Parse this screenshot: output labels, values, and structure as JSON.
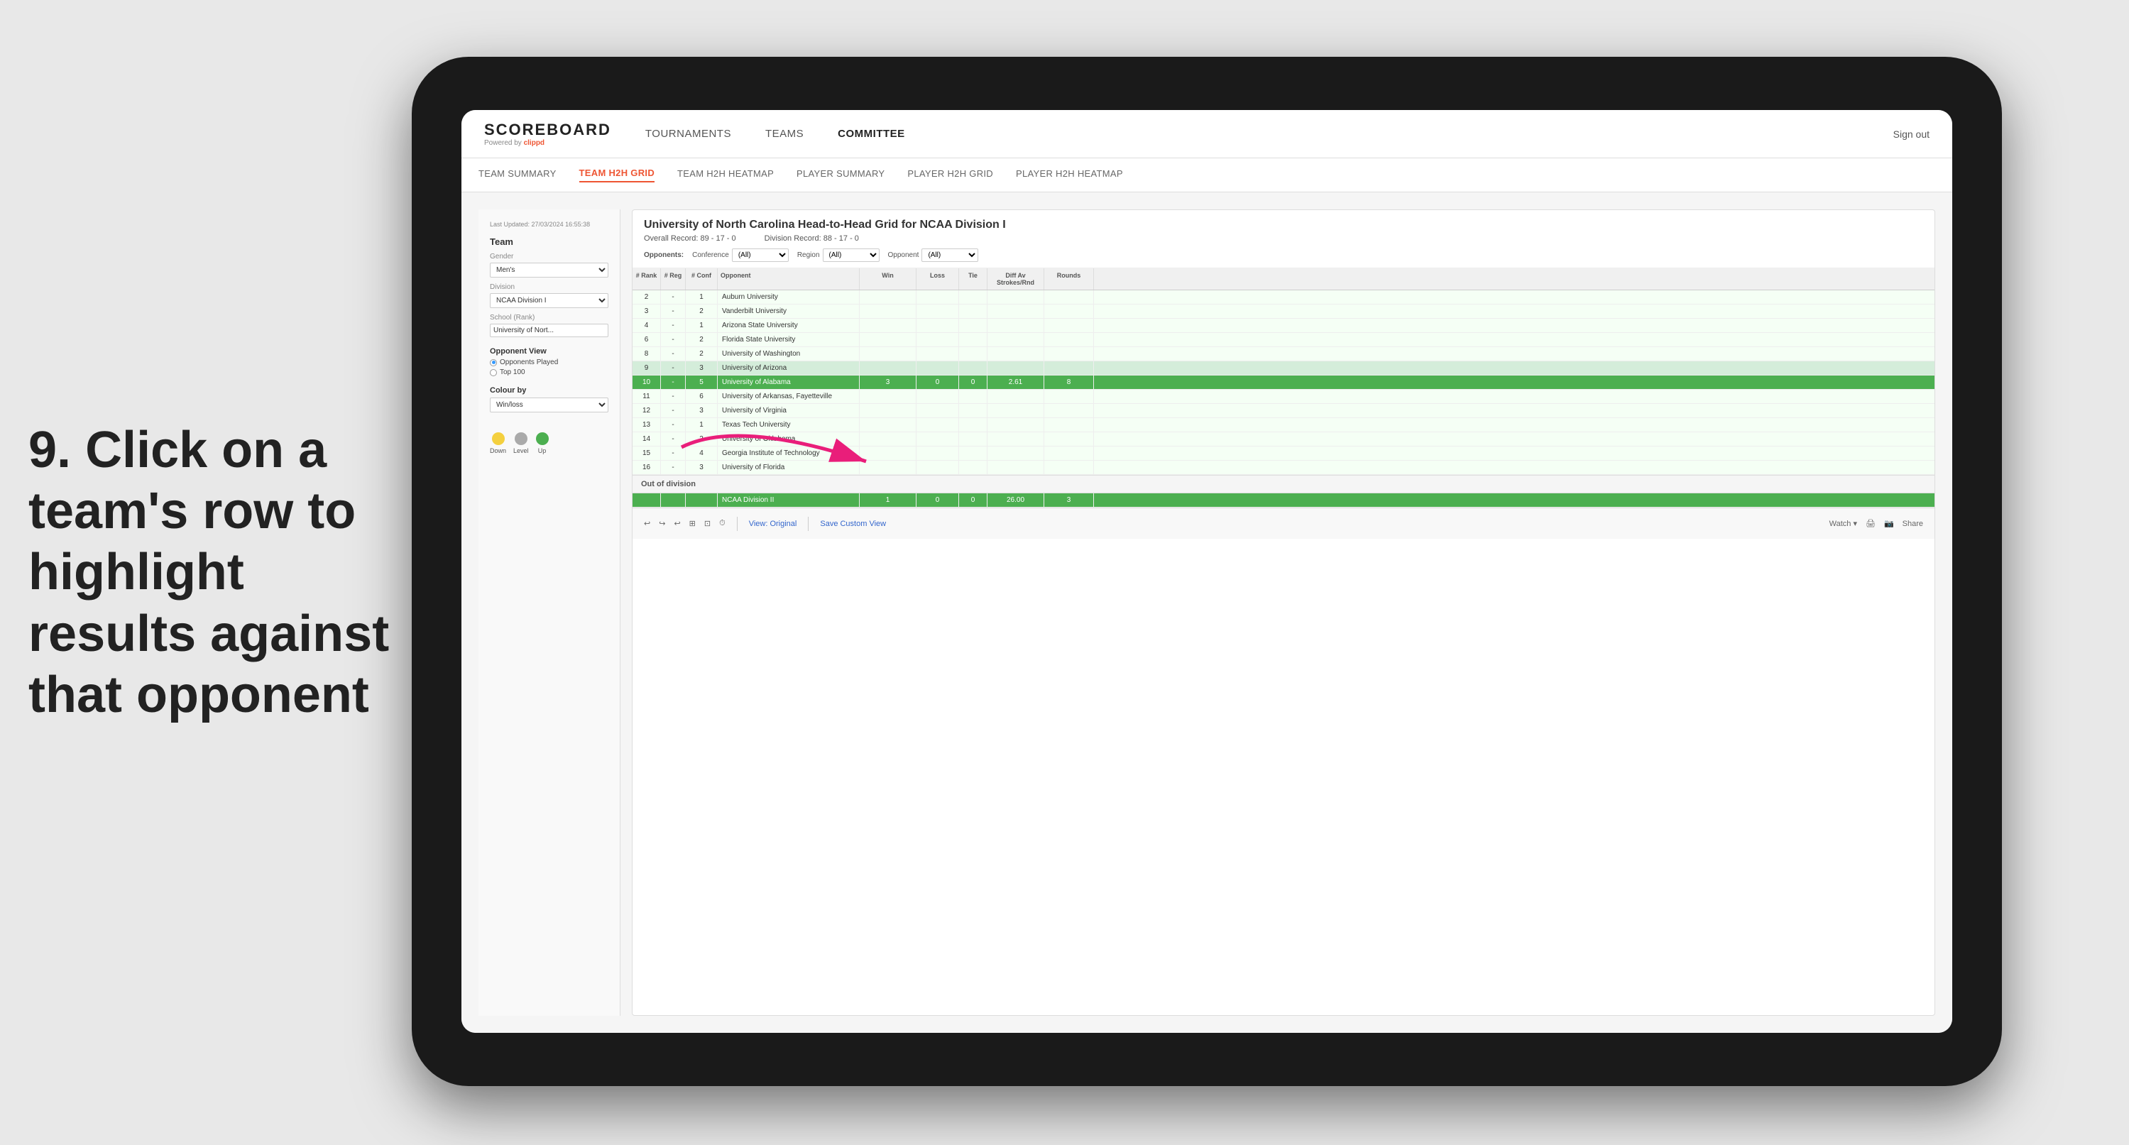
{
  "instruction": {
    "step": "9.",
    "text": "Click on a team's row to highlight results against that opponent"
  },
  "app": {
    "logo": "SCOREBOARD",
    "logo_sub": "Powered by",
    "logo_brand": "clippd",
    "sign_out": "Sign out"
  },
  "nav": {
    "items": [
      {
        "label": "TOURNAMENTS"
      },
      {
        "label": "TEAMS"
      },
      {
        "label": "COMMITTEE"
      }
    ]
  },
  "sub_nav": {
    "items": [
      {
        "label": "TEAM SUMMARY"
      },
      {
        "label": "TEAM H2H GRID",
        "active": true
      },
      {
        "label": "TEAM H2H HEATMAP"
      },
      {
        "label": "PLAYER SUMMARY"
      },
      {
        "label": "PLAYER H2H GRID"
      },
      {
        "label": "PLAYER H2H HEATMAP"
      }
    ]
  },
  "left_panel": {
    "last_updated": "Last Updated: 27/03/2024 16:55:38",
    "section_title": "Team",
    "gender_label": "Gender",
    "gender_value": "Men's",
    "division_label": "Division",
    "division_value": "NCAA Division I",
    "school_label": "School (Rank)",
    "school_value": "University of Nort...",
    "opponent_view_title": "Opponent View",
    "radio_options": [
      {
        "label": "Opponents Played",
        "selected": true
      },
      {
        "label": "Top 100"
      }
    ],
    "colour_by_title": "Colour by",
    "colour_by_value": "Win/loss",
    "legend": [
      {
        "label": "Down",
        "color": "#f4d03f"
      },
      {
        "label": "Level",
        "color": "#aaaaaa"
      },
      {
        "label": "Up",
        "color": "#4caf50"
      }
    ]
  },
  "grid": {
    "title": "University of North Carolina Head-to-Head Grid for NCAA Division I",
    "overall_record": "Overall Record: 89 - 17 - 0",
    "division_record": "Division Record: 88 - 17 - 0",
    "filters": {
      "opponents_label": "Opponents:",
      "conference_label": "Conference",
      "conference_value": "(All)",
      "region_label": "Region",
      "region_value": "(All)",
      "opponent_label": "Opponent",
      "opponent_value": "(All)"
    },
    "columns": [
      "# Rank",
      "# Reg",
      "# Conf",
      "Opponent",
      "Win",
      "Loss",
      "Tie",
      "Diff Av Strokes/Rnd",
      "Rounds"
    ],
    "rows": [
      {
        "rank": "2",
        "reg": "-",
        "conf": "1",
        "opponent": "Auburn University",
        "win": "",
        "loss": "",
        "tie": "",
        "diff": "",
        "rounds": "",
        "row_class": "light"
      },
      {
        "rank": "3",
        "reg": "-",
        "conf": "2",
        "opponent": "Vanderbilt University",
        "win": "",
        "loss": "",
        "tie": "",
        "diff": "",
        "rounds": "",
        "row_class": "light"
      },
      {
        "rank": "4",
        "reg": "-",
        "conf": "1",
        "opponent": "Arizona State University",
        "win": "",
        "loss": "",
        "tie": "",
        "diff": "",
        "rounds": "",
        "row_class": "light"
      },
      {
        "rank": "6",
        "reg": "-",
        "conf": "2",
        "opponent": "Florida State University",
        "win": "",
        "loss": "",
        "tie": "",
        "diff": "",
        "rounds": "",
        "row_class": "light"
      },
      {
        "rank": "8",
        "reg": "-",
        "conf": "2",
        "opponent": "University of Washington",
        "win": "",
        "loss": "",
        "tie": "",
        "diff": "",
        "rounds": "",
        "row_class": "light"
      },
      {
        "rank": "9",
        "reg": "-",
        "conf": "3",
        "opponent": "University of Arizona",
        "win": "",
        "loss": "",
        "tie": "",
        "diff": "",
        "rounds": "",
        "row_class": "light-green"
      },
      {
        "rank": "10",
        "reg": "-",
        "conf": "5",
        "opponent": "University of Alabama",
        "win": "3",
        "loss": "0",
        "tie": "0",
        "diff": "2.61",
        "rounds": "8",
        "row_class": "green-highlight"
      },
      {
        "rank": "11",
        "reg": "-",
        "conf": "6",
        "opponent": "University of Arkansas, Fayetteville",
        "win": "",
        "loss": "",
        "tie": "",
        "diff": "",
        "rounds": "",
        "row_class": "light"
      },
      {
        "rank": "12",
        "reg": "-",
        "conf": "3",
        "opponent": "University of Virginia",
        "win": "",
        "loss": "",
        "tie": "",
        "diff": "",
        "rounds": "",
        "row_class": "light"
      },
      {
        "rank": "13",
        "reg": "-",
        "conf": "1",
        "opponent": "Texas Tech University",
        "win": "",
        "loss": "",
        "tie": "",
        "diff": "",
        "rounds": "",
        "row_class": "light"
      },
      {
        "rank": "14",
        "reg": "-",
        "conf": "2",
        "opponent": "University of Oklahoma",
        "win": "",
        "loss": "",
        "tie": "",
        "diff": "",
        "rounds": "",
        "row_class": "light"
      },
      {
        "rank": "15",
        "reg": "-",
        "conf": "4",
        "opponent": "Georgia Institute of Technology",
        "win": "",
        "loss": "",
        "tie": "",
        "diff": "",
        "rounds": "",
        "row_class": "light"
      },
      {
        "rank": "16",
        "reg": "-",
        "conf": "3",
        "opponent": "University of Florida",
        "win": "",
        "loss": "",
        "tie": "",
        "diff": "",
        "rounds": "",
        "row_class": "light"
      }
    ],
    "out_of_division": {
      "label": "Out of division",
      "row": {
        "name": "NCAA Division II",
        "win": "1",
        "loss": "0",
        "tie": "0",
        "diff": "26.00",
        "rounds": "3"
      }
    }
  },
  "toolbar": {
    "undo": "↩",
    "redo": "↪",
    "view_original": "View: Original",
    "save_custom": "Save Custom View",
    "watch": "Watch ▾",
    "share": "Share"
  }
}
